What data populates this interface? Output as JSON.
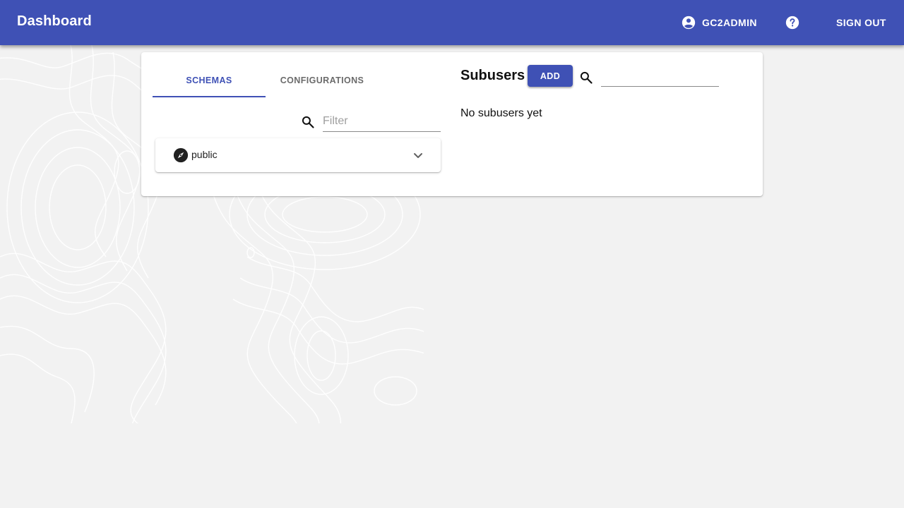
{
  "header": {
    "title": "Dashboard",
    "username": "GC2ADMIN",
    "help_icon": "help-circle-icon",
    "user_icon": "account-circle-icon",
    "signout_label": "SIGN OUT",
    "background_color": "#3f51b5"
  },
  "schemas_panel": {
    "tabs": [
      {
        "label": "SCHEMAS",
        "active": true
      },
      {
        "label": "CONFIGURATIONS",
        "active": false
      }
    ],
    "filter": {
      "placeholder": "Filter",
      "value": ""
    },
    "schemas": [
      {
        "name": "public",
        "icon": "compass-icon",
        "expanded": false
      }
    ]
  },
  "subusers_panel": {
    "title": "Subusers",
    "add_label": "ADD",
    "search_value": "",
    "empty_message": "No subusers yet"
  },
  "colors": {
    "primary": "#3f51b5",
    "background": "#f2f2f2"
  }
}
